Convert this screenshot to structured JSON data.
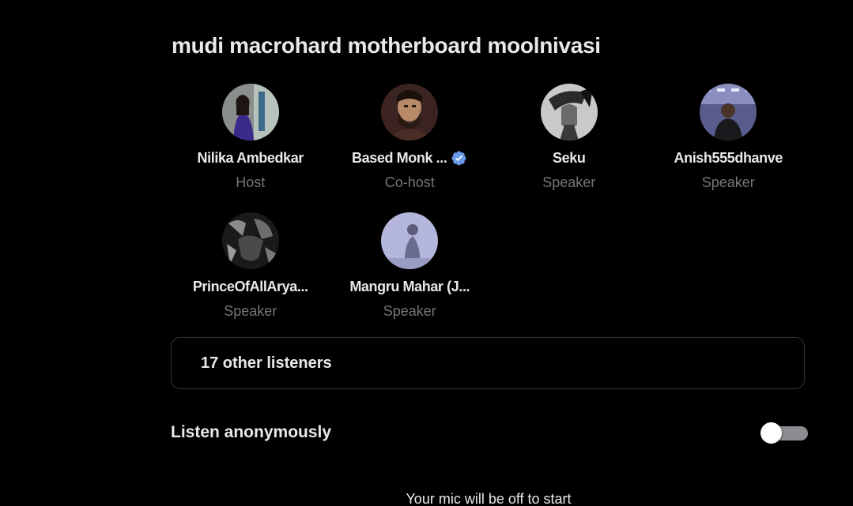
{
  "space": {
    "title": "mudi macrohard motherboard moolnivasi"
  },
  "participants": [
    {
      "name": "Nilika Ambedkar",
      "role": "Host",
      "avatar": "avatar-nilika",
      "verified": false
    },
    {
      "name": "Based Monk ...",
      "role": "Co-host",
      "avatar": "avatar-based-monk",
      "verified": true
    },
    {
      "name": "Seku",
      "role": "Speaker",
      "avatar": "avatar-seku",
      "verified": false
    },
    {
      "name": "Anish555dhanve",
      "role": "Speaker",
      "avatar": "avatar-anish",
      "verified": false
    },
    {
      "name": "PrinceOfAllArya...",
      "role": "Speaker",
      "avatar": "avatar-prince",
      "verified": false
    },
    {
      "name": "Mangru Mahar (J...",
      "role": "Speaker",
      "avatar": "avatar-mangru",
      "verified": false
    }
  ],
  "listeners": {
    "label": "17 other listeners"
  },
  "anonymous": {
    "label": "Listen anonymously",
    "enabled": false
  },
  "mic_note": "Your mic will be off to start",
  "colors": {
    "background": "#000000",
    "text_primary": "#e7e9ea",
    "text_secondary": "#71767b",
    "border": "#2f3336",
    "verified_badge": "#1d9bf0",
    "toggle_track_off": "#8b8d90"
  },
  "icons": {
    "verified": "verified-badge-icon"
  }
}
